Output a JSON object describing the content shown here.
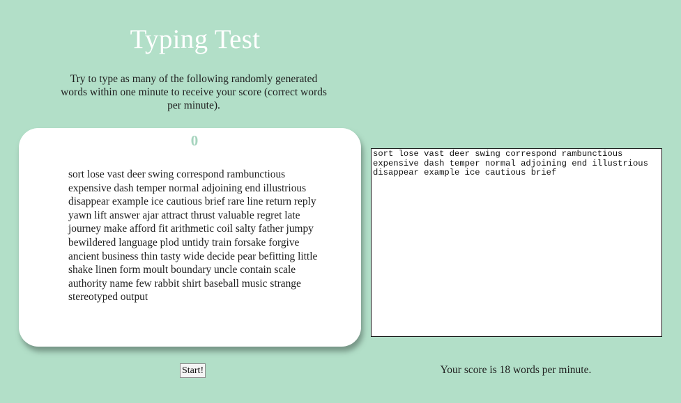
{
  "header": {
    "title": "Typing Test",
    "instructions": "Try to type as many of the following randomly generated words within one minute to receive your score (correct words per minute)."
  },
  "word_card": {
    "timer": "0",
    "words": "sort lose vast deer swing correspond rambunctious expensive dash temper normal adjoining end illustrious disappear example ice cautious brief rare line return reply yawn lift answer ajar attract thrust valuable regret late journey make afford fit arithmetic coil salty father jumpy bewildered language plod untidy train forsake forgive ancient business thin tasty wide decide pear befitting little shake linen form moult boundary uncle contain scale authority name few rabbit shirt baseball music strange stereotyped output"
  },
  "typing_area": {
    "value": "sort lose vast deer swing correspond rambunctious expensive dash temper normal adjoining end illustrious disappear example ice cautious brief "
  },
  "controls": {
    "start_label": "Start!"
  },
  "result": {
    "score_text": "Your score is 18 words per minute."
  },
  "colors": {
    "background": "#b2dfc8",
    "title": "#ffffff",
    "timer": "#a6d4be",
    "card": "#ffffff"
  }
}
